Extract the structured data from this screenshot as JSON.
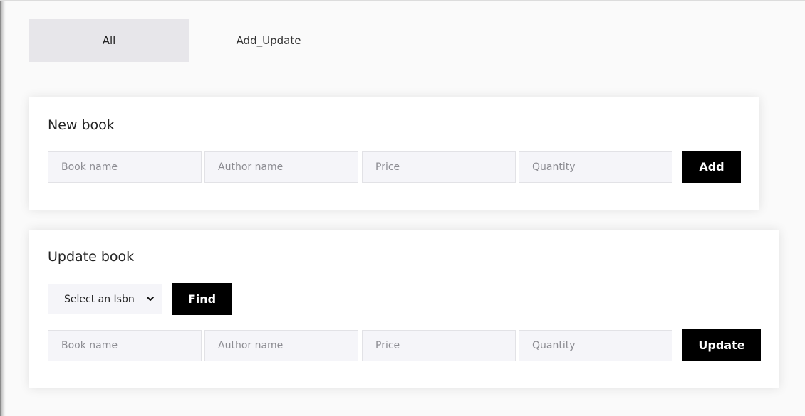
{
  "tabs": [
    {
      "label": "All",
      "active": true
    },
    {
      "label": "Add_Update",
      "active": false
    }
  ],
  "new_book": {
    "title": "New book",
    "fields": {
      "book_name_placeholder": "Book name",
      "author_name_placeholder": "Author name",
      "price_placeholder": "Price",
      "quantity_placeholder": "Quantity"
    },
    "add_label": "Add"
  },
  "update_book": {
    "title": "Update book",
    "isbn_select": {
      "selected": "Select an Isbn",
      "icon": "chevron-down-icon"
    },
    "find_label": "Find",
    "fields": {
      "book_name_placeholder": "Book name",
      "author_name_placeholder": "Author name",
      "price_placeholder": "Price",
      "quantity_placeholder": "Quantity"
    },
    "update_label": "Update"
  },
  "colors": {
    "active_tab_bg": "#e7e6ea",
    "input_bg": "#f5f5f9",
    "button_bg": "#000000",
    "button_text": "#ffffff"
  }
}
